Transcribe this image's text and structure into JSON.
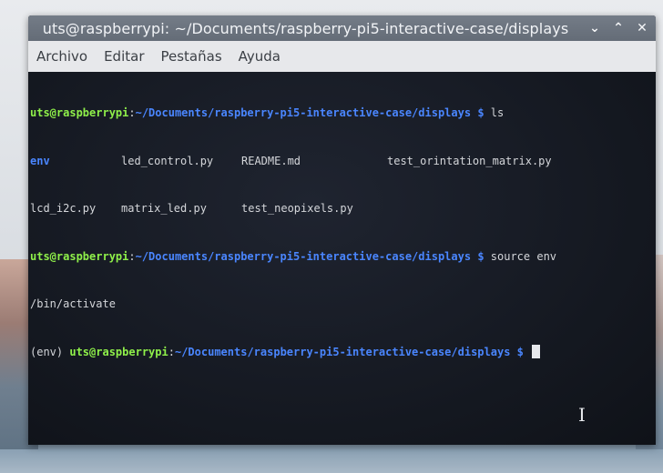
{
  "window": {
    "title": "uts@raspberrypi: ~/Documents/raspberry-pi5-interactive-case/displays",
    "controls": {
      "minimize": "⌄",
      "maximize": "⌃",
      "close": "✕"
    }
  },
  "menubar": {
    "items": [
      "Archivo",
      "Editar",
      "Pestañas",
      "Ayuda"
    ]
  },
  "terminal": {
    "prompt_user": "uts@raspberrypi",
    "prompt_path": "~/Documents/raspberry-pi5-interactive-case/displays",
    "prompt_symbol": "$",
    "cmd1": "ls",
    "ls_row1": [
      "env",
      "led_control.py",
      "README.md",
      "test_orintation_matrix.py"
    ],
    "ls_row2": [
      "lcd_i2c.py",
      "matrix_led.py",
      "test_neopixels.py"
    ],
    "cmd2_part1": "source env",
    "cmd2_part2": "/bin/activate",
    "venv_prefix": "(env)"
  }
}
